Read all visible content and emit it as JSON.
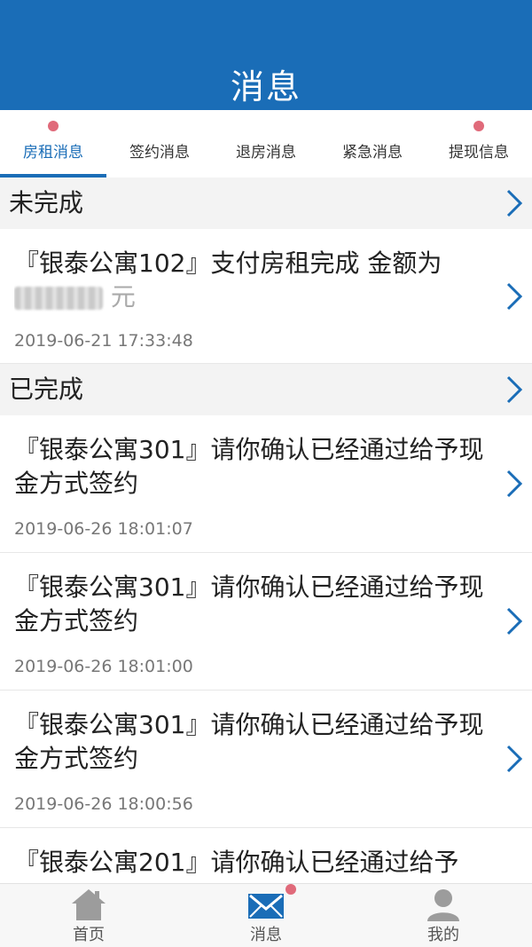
{
  "header": {
    "title": "消息"
  },
  "tabs": [
    {
      "label": "房租消息",
      "active": true,
      "dot": true
    },
    {
      "label": "签约消息",
      "active": false,
      "dot": false
    },
    {
      "label": "退房消息",
      "active": false,
      "dot": false
    },
    {
      "label": "紧急消息",
      "active": false,
      "dot": false
    },
    {
      "label": "提现信息",
      "active": false,
      "dot": true
    }
  ],
  "sections": {
    "incomplete": {
      "title": "未完成",
      "items": [
        {
          "text": "『银泰公寓102』支付房租完成 金额为",
          "text_line2": "元",
          "time": "2019-06-21 17:33:48"
        }
      ]
    },
    "complete": {
      "title": "已完成",
      "items": [
        {
          "text": "『银泰公寓301』请你确认已经通过给予现金方式签约",
          "time": "2019-06-26 18:01:07"
        },
        {
          "text": "『银泰公寓301』请你确认已经通过给予现金方式签约",
          "time": "2019-06-26 18:01:00"
        },
        {
          "text": "『银泰公寓301』请你确认已经通过给予现金方式签约",
          "time": "2019-06-26 18:00:56"
        },
        {
          "text": "『银泰公寓201』请你确认已经通过给予",
          "time": ""
        }
      ]
    }
  },
  "tabbar": [
    {
      "label": "首页",
      "icon": "home-icon"
    },
    {
      "label": "消息",
      "icon": "mail-icon",
      "badge_dot": true
    },
    {
      "label": "我的",
      "icon": "user-icon"
    }
  ],
  "colors": {
    "primary": "#1a6db7",
    "dot": "#e06a7a"
  }
}
